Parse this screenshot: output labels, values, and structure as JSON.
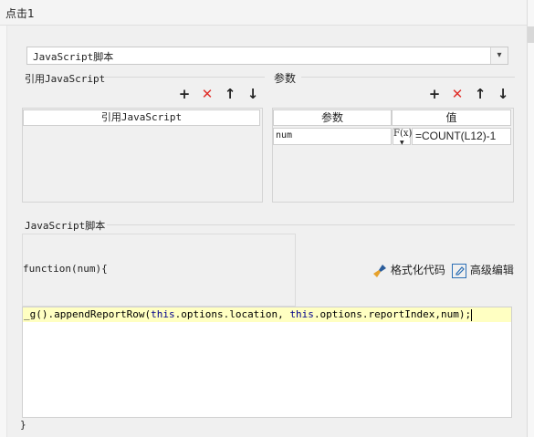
{
  "window": {
    "title": "点击1"
  },
  "script_type": {
    "selected": "JavaScript脚本"
  },
  "references": {
    "title": "引用JavaScript",
    "column_header": "引用JavaScript",
    "toolbar": {
      "add": "+",
      "delete": "✕",
      "up": "↑",
      "down": "↓"
    }
  },
  "params": {
    "title": "参数",
    "headers": [
      "参数",
      "值"
    ],
    "rows": [
      {
        "name": "num",
        "formula_btn": "F(x)",
        "value": "=COUNT(L12)-1"
      }
    ],
    "toolbar": {
      "add": "+",
      "delete": "✕",
      "up": "↑",
      "down": "↓"
    }
  },
  "script": {
    "title": "JavaScript脚本",
    "function_header": "function(num){",
    "format_label": "格式化代码",
    "advanced_label": "高级编辑",
    "code_line": {
      "p1": "_g",
      "p2": "().appendReportRow(",
      "p3": "this",
      "p4": ".options.location, ",
      "p5": "this",
      "p6": ".options.reportIndex,num);"
    },
    "closing": "}"
  }
}
